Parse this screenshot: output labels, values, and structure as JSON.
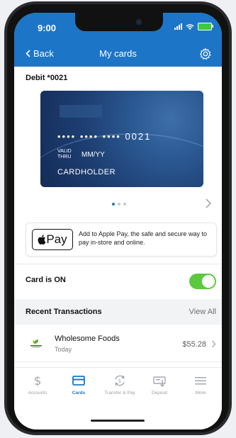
{
  "status": {
    "time": "9:00"
  },
  "nav": {
    "back_label": "Back",
    "title": "My cards",
    "settings_icon": "gear-icon"
  },
  "card": {
    "label": "Debit *0021",
    "masked_number": "•••• •••• •••• 0021",
    "valid_thru_line1": "VALID",
    "valid_thru_line2": "THRU",
    "expiry": "MM/YY",
    "holder": "CARDHOLDER"
  },
  "pager": {
    "pages": 3,
    "current": 1
  },
  "apple_pay": {
    "badge_text": "Pay",
    "description": "Add to Apple Pay, the safe and secure way to pay in-store and online."
  },
  "card_status": {
    "label": "Card is ON",
    "on": true
  },
  "transactions": {
    "title": "Recent Transactions",
    "view_all": "View All",
    "items": [
      {
        "merchant": "Wholesome Foods",
        "date": "Today",
        "amount": "$55.28"
      }
    ]
  },
  "tabs": [
    {
      "label": "Accounts",
      "icon": "dollar-icon",
      "active": false
    },
    {
      "label": "Cards",
      "icon": "card-icon",
      "active": true
    },
    {
      "label": "Transfer & Pay",
      "icon": "transfer-icon",
      "active": false
    },
    {
      "label": "Deposit",
      "icon": "deposit-icon",
      "active": false
    },
    {
      "label": "More",
      "icon": "menu-icon",
      "active": false
    }
  ],
  "colors": {
    "brand_blue": "#1c75c6",
    "toggle_green": "#5cc93f"
  }
}
